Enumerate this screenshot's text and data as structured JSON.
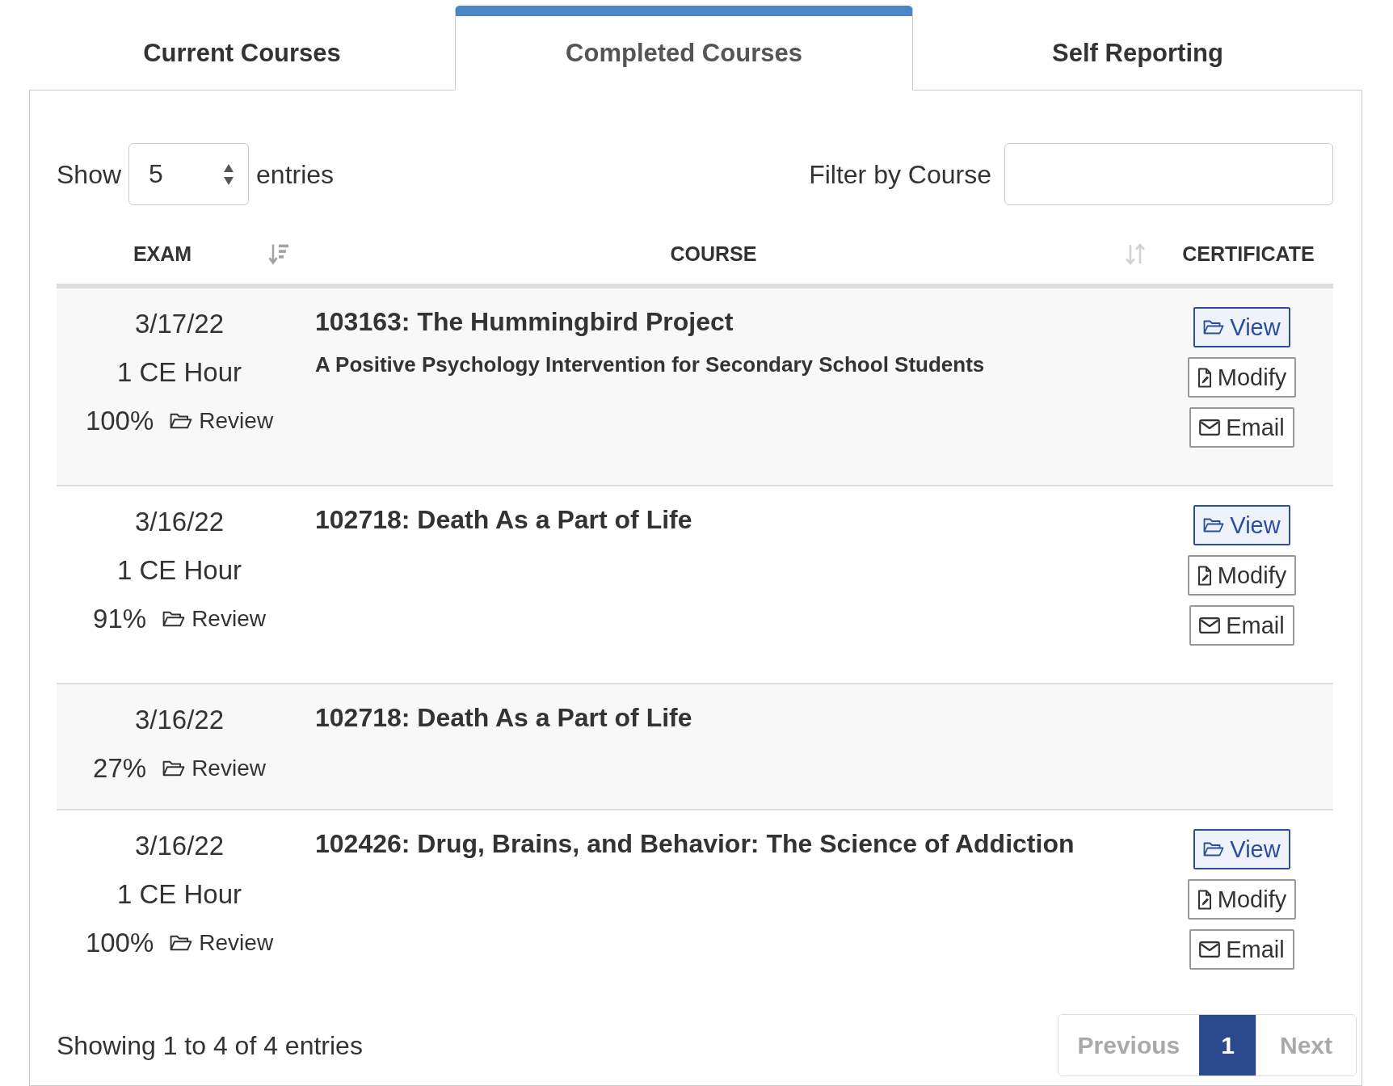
{
  "tabs": [
    {
      "label": "Current Courses",
      "selected": false
    },
    {
      "label": "Completed Courses",
      "selected": true
    },
    {
      "label": "Self Reporting",
      "selected": false
    }
  ],
  "length_control": {
    "label": "Show",
    "value": "5",
    "suffix": "entries"
  },
  "filter": {
    "label": "Filter by Course"
  },
  "table": {
    "columns": [
      {
        "label": "EXAM",
        "sortable": true,
        "sorted": true
      },
      {
        "label": "COURSE",
        "sortable": true,
        "sorted": false
      },
      {
        "label": "CERTIFICATE",
        "sortable": false,
        "sorted": false
      }
    ],
    "rows": [
      {
        "date": "3/17/22",
        "credit": "1 CE Hour",
        "score": "100%",
        "review": "Review",
        "title": "103163: The Hummingbird Project",
        "subtitle": "A Positive Psychology Intervention for Secondary School Students",
        "actions": [
          {
            "kind": "view",
            "label": "View"
          },
          {
            "kind": "modify",
            "label": "Modify"
          },
          {
            "kind": "email",
            "label": "Email"
          }
        ]
      },
      {
        "date": "3/16/22",
        "credit": "1 CE Hour",
        "score": "91%",
        "review": "Review",
        "title": "102718: Death As a Part of Life",
        "actions": [
          {
            "kind": "view",
            "label": "View"
          },
          {
            "kind": "modify",
            "label": "Modify"
          },
          {
            "kind": "email",
            "label": "Email"
          }
        ]
      },
      {
        "date": "3/16/22",
        "score": "27%",
        "review": "Review",
        "title": "102718: Death As a Part of Life"
      },
      {
        "date": "3/16/22",
        "credit": "1 CE Hour",
        "score": "100%",
        "review": "Review",
        "title": "102426: Drug, Brains, and Behavior: The Science of Addiction",
        "actions": [
          {
            "kind": "view",
            "label": "View"
          },
          {
            "kind": "modify",
            "label": "Modify"
          },
          {
            "kind": "email",
            "label": "Email"
          }
        ]
      }
    ]
  },
  "info": "Showing 1 to 4 of 4 entries",
  "pagination": [
    {
      "kind": "previous",
      "label": "Previous",
      "disabled": true,
      "selected": false
    },
    {
      "kind": "page",
      "label": "1",
      "disabled": false,
      "selected": true
    },
    {
      "kind": "next",
      "label": "Next",
      "disabled": true,
      "selected": false
    }
  ]
}
